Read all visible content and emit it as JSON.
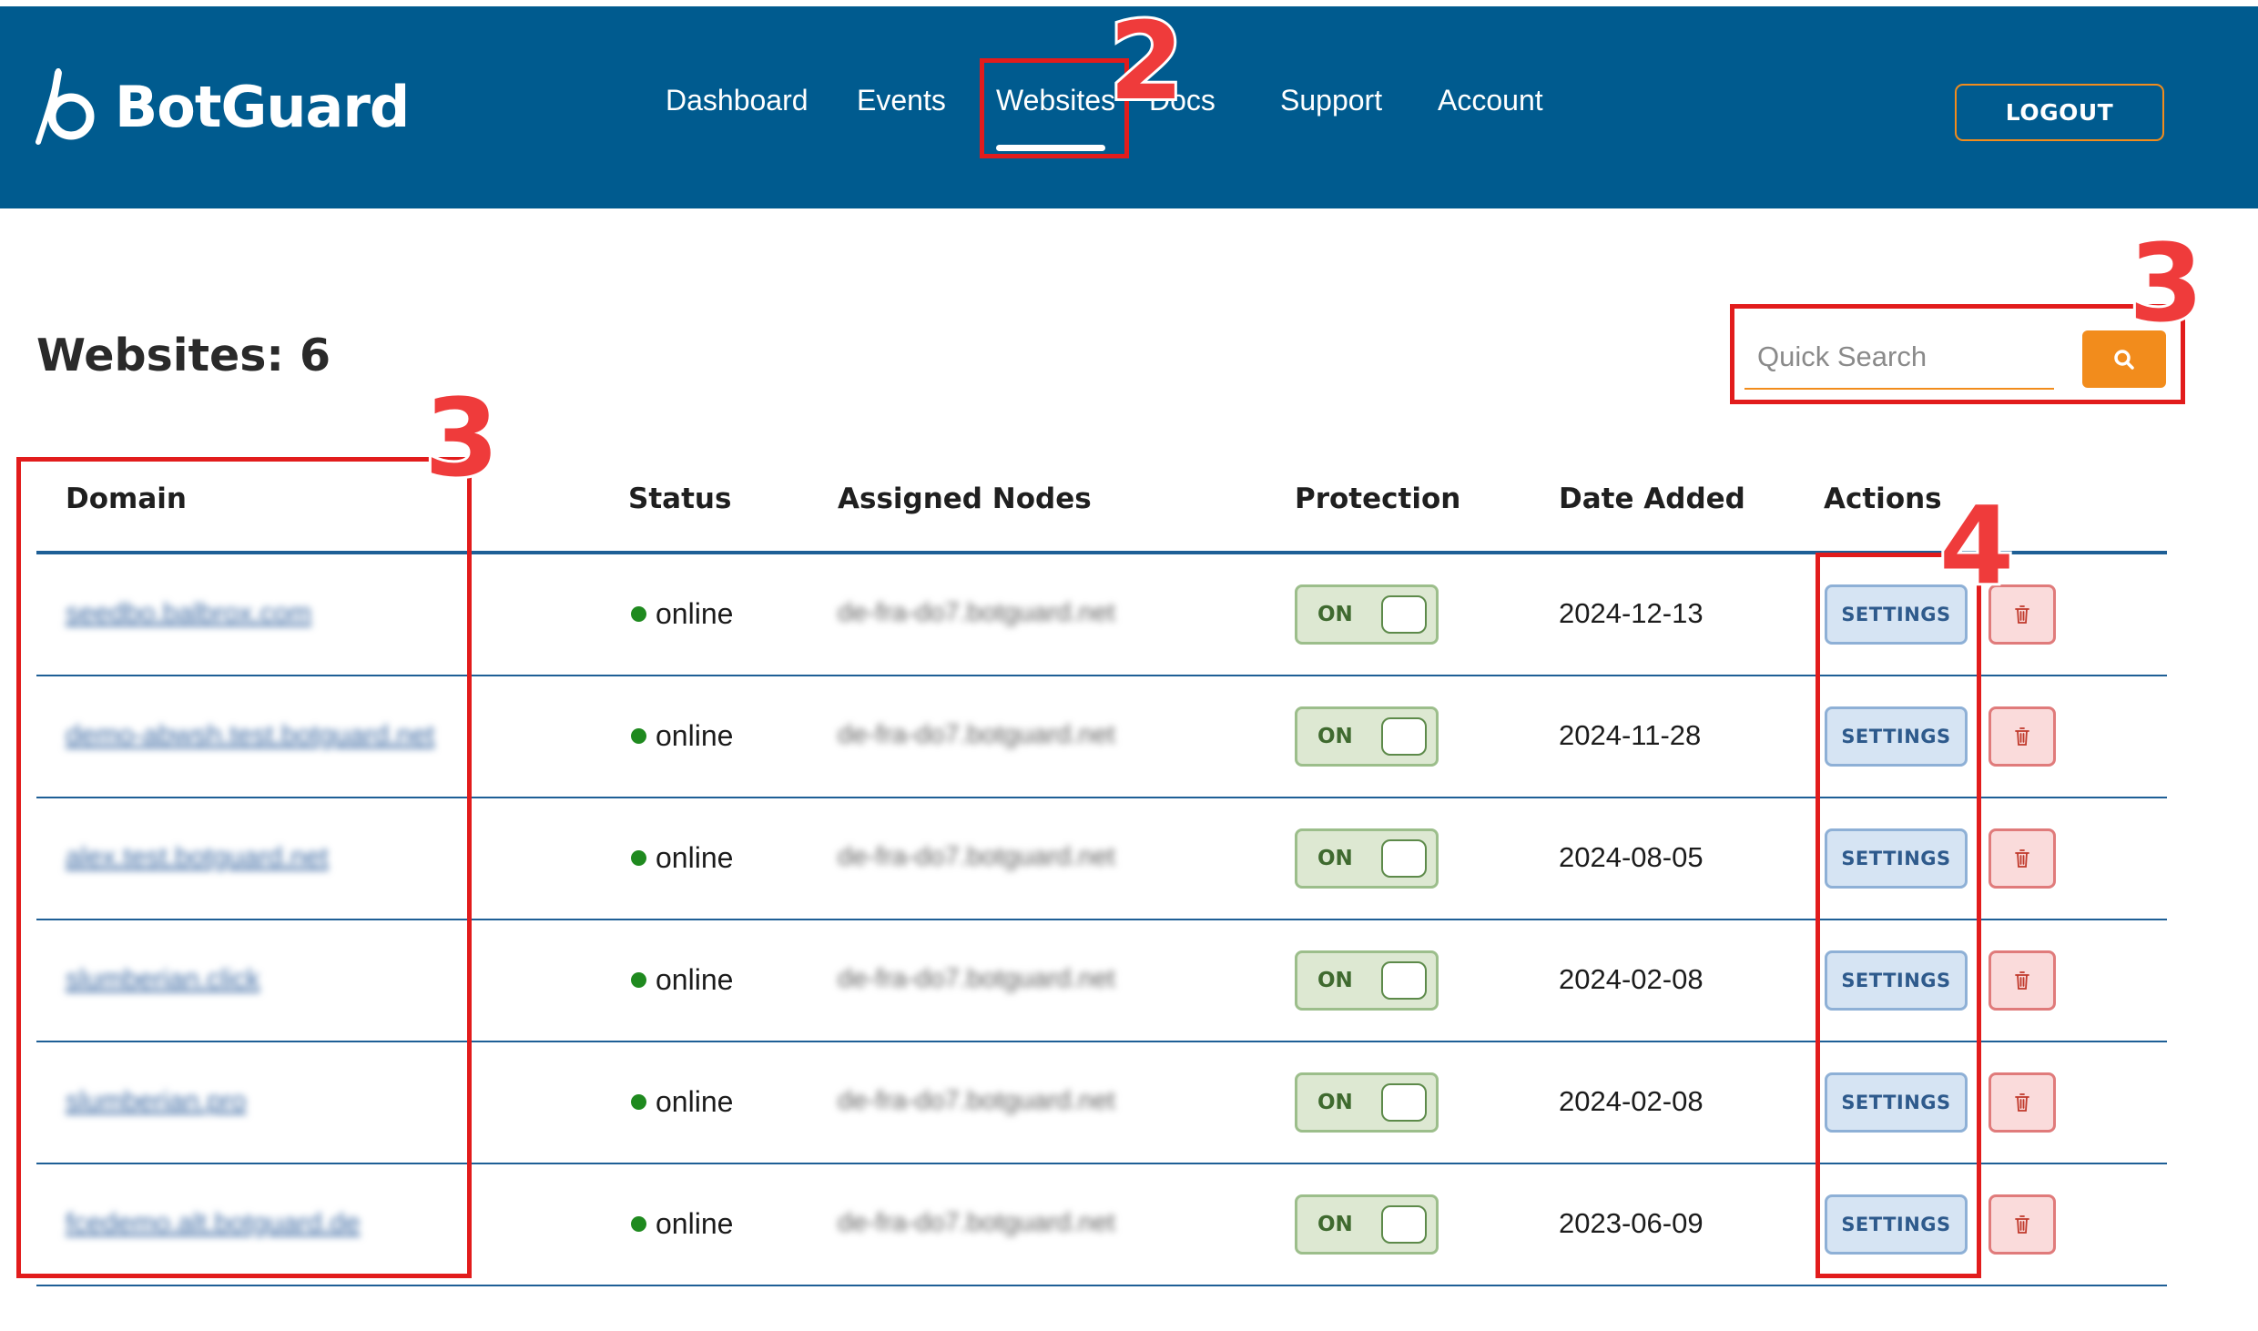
{
  "app": {
    "name": "BotGuard"
  },
  "nav": {
    "items": [
      {
        "label": "Dashboard"
      },
      {
        "label": "Events"
      },
      {
        "label": "Websites"
      },
      {
        "label": "Docs"
      },
      {
        "label": "Support"
      },
      {
        "label": "Account"
      }
    ],
    "active": "Websites",
    "logout_label": "LOGOUT"
  },
  "page": {
    "title": "Websites: 6"
  },
  "search": {
    "placeholder": "Quick Search",
    "icon": "search-icon"
  },
  "table": {
    "columns": [
      "Domain",
      "Status",
      "Assigned Nodes",
      "Protection",
      "Date Added",
      "Actions"
    ],
    "rows": [
      {
        "domain": "seedbo.balbrox.com",
        "status": "online",
        "nodes": "de-fra-do7.botguard.net",
        "protection": "ON",
        "date": "2024-12-13"
      },
      {
        "domain": "demo-abwsh.test.botguard.net",
        "status": "online",
        "nodes": "de-fra-do7.botguard.net",
        "protection": "ON",
        "date": "2024-11-28"
      },
      {
        "domain": "alex.test.botguard.net",
        "status": "online",
        "nodes": "de-fra-do7.botguard.net",
        "protection": "ON",
        "date": "2024-08-05"
      },
      {
        "domain": "slumberian.click",
        "status": "online",
        "nodes": "de-fra-do7.botguard.net",
        "protection": "ON",
        "date": "2024-02-08"
      },
      {
        "domain": "slumberian.pro",
        "status": "online",
        "nodes": "de-fra-do7.botguard.net",
        "protection": "ON",
        "date": "2024-02-08"
      },
      {
        "domain": "fcedemo.alt.botguard.de",
        "status": "online",
        "nodes": "de-fra-do7.botguard.net",
        "protection": "ON",
        "date": "2023-06-09"
      }
    ],
    "settings_label": "SETTINGS",
    "delete_icon": "trash-icon"
  },
  "colors": {
    "header_bg": "#005b8f",
    "accent": "#f28c1c",
    "online": "#1f8a1f",
    "annotation": "#e21c1c"
  },
  "annotations": [
    "2",
    "3",
    "3",
    "4"
  ]
}
